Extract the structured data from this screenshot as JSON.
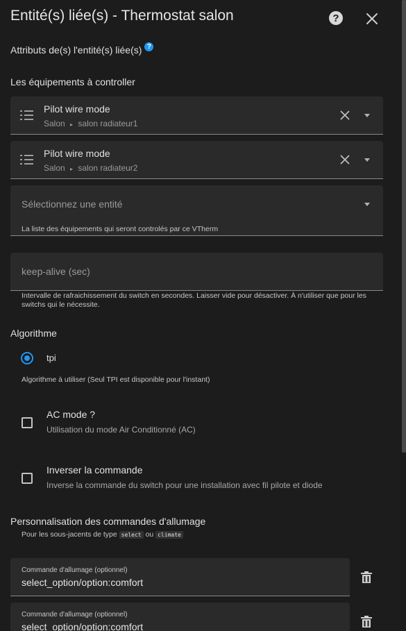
{
  "dialog": {
    "title": "Entité(s) liée(s) - Thermostat salon",
    "help_icon": "help-circle-icon",
    "close_icon": "close-icon"
  },
  "linked_attributes": {
    "label": "Attributs de(s) l'entité(s) liée(s)",
    "info_badge": "?"
  },
  "equipment": {
    "heading": "Les équipements à controller",
    "items": [
      {
        "name": "Pilot wire mode",
        "area": "Salon",
        "separator": "▸",
        "device": "salon radiateur1"
      },
      {
        "name": "Pilot wire mode",
        "area": "Salon",
        "separator": "▸",
        "device": "salon radiateur2"
      }
    ],
    "select_placeholder": "Sélectionnez une entité",
    "helper": "La liste des équipements qui seront controlés par ce VTherm"
  },
  "keep_alive": {
    "placeholder": "keep-alive (sec)",
    "helper": "Intervalle de rafraichissement du switch en secondes. Laisser vide pour désactiver. À n'utiliser que pour les switchs qui le nécessite."
  },
  "algorithm": {
    "heading": "Algorithme",
    "selected_option": "tpi",
    "helper": "Algorithme à utiliser (Seul TPI est disponible pour l'instant)"
  },
  "options": {
    "ac_mode": {
      "title": "AC mode ?",
      "description": "Utilisation du mode Air Conditionné (AC)",
      "checked": false
    },
    "invert": {
      "title": "Inverser la commande",
      "description": "Inverse la commande du switch pour une installation avec fil pilote et diode",
      "checked": false
    }
  },
  "commands": {
    "heading": "Personnalisation des commandes d'allumage",
    "sub_prefix": "Pour les sous-jacents de type",
    "code_select": "select",
    "sub_or": "ou",
    "code_climate": "climate",
    "items": [
      {
        "label": "Commande d'allumage (optionnel)",
        "value": "select_option/option:comfort"
      },
      {
        "label": "Commande d'allumage (optionnel)",
        "value": "select_option/option:comfort"
      }
    ]
  },
  "colors": {
    "background": "#1c1c1c",
    "field": "#2a2a2a",
    "accent": "#2196f3"
  }
}
